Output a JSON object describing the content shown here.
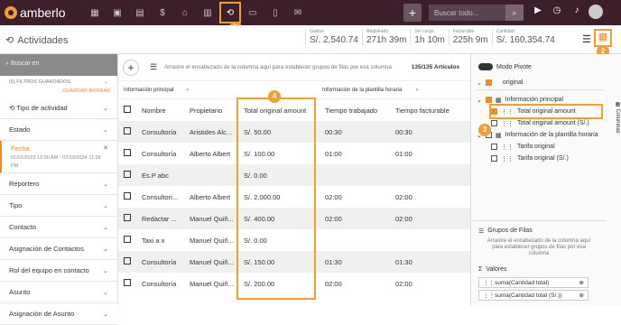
{
  "app": {
    "name": "amberlo"
  },
  "search": {
    "placeholder": "Buscar todo..."
  },
  "page": {
    "title": "Actividades"
  },
  "stats": [
    {
      "label": "Gastos",
      "value": "S/. 2,540.74"
    },
    {
      "label": "Registrado",
      "value": "271h 39m"
    },
    {
      "label": "Sin cargo",
      "value": "1h 10m"
    },
    {
      "label": "Facturable",
      "value": "225h 9m"
    },
    {
      "label": "Cantidad",
      "value": "S/. 160,354.74"
    }
  ],
  "left": {
    "search_placeholder": "Buscar en",
    "filters_saved": "(5) FILTROS GUARDADOS",
    "save": "GUARDAR",
    "clear": "BORRAR",
    "items": [
      "Tipo de actividad",
      "Estado",
      "Fecha",
      "Reportero",
      "Tipo",
      "Contacto",
      "Asignación de Contactos",
      "Rol del equipo en contacto",
      "Asunto",
      "Asignación de Asunto"
    ],
    "date_range": "01/01/2023 12:00 AM - 07/10/2024 11:59 PM"
  },
  "grid": {
    "group_hint": "Arrastre el encabezado de la columna aquí para establecer grupos de filas por esa columna",
    "count": "135/135 Artículos",
    "group1": "Información principal",
    "group2": "Información de la plantilla horaria",
    "headers": [
      "Nombre",
      "Propietario",
      "Total original amount",
      "Tiempo trabajado",
      "Tiempo facturable"
    ],
    "rows": [
      [
        "Consultoría",
        "Aristides Alc...",
        "S/. 50.00",
        "00:30",
        "00:30"
      ],
      [
        "Consultoría",
        "Alberto Albert",
        "S/. 100.00",
        "01:00",
        "01:00"
      ],
      [
        "Es.P abc",
        "",
        "S/. 0.00",
        "",
        ""
      ],
      [
        "Consultori...",
        "Alberto Albert",
        "S/. 2,000.00",
        "02:00",
        "02:00"
      ],
      [
        "Redactar ...",
        "Manuel Quiñ...",
        "S/. 400.00",
        "02:00",
        "02:00"
      ],
      [
        "Taxi a x",
        "Manuel Quiñ...",
        "S/. 0.00",
        "",
        ""
      ],
      [
        "Consultoría",
        "Manuel Quiñ...",
        "S/. 150.00",
        "01:30",
        "01:30"
      ],
      [
        "Consultoría",
        "Manuel Quiñ...",
        "S/. 200.00",
        "02:00",
        "02:00"
      ]
    ]
  },
  "pivot": {
    "mode": "Modo Pivote",
    "search_value": "original",
    "tree": [
      "Información principal",
      "Total original amount",
      "Total original amount (S/.)",
      "Información de la plantilla horaria",
      "Tarifa original",
      "Tarifa original (S/.)"
    ],
    "groups_title": "Grupos de Filas",
    "groups_hint": "Arrastre el encabezado de la columna aquí para establecer grupos de filas por esa columna",
    "values_title": "Valores",
    "values": [
      "suma(Cantidad total)",
      "suma(Cantidad total (S/.))"
    ],
    "side_tab": "Columnas"
  },
  "badges": [
    "1",
    "2",
    "3",
    "4"
  ]
}
